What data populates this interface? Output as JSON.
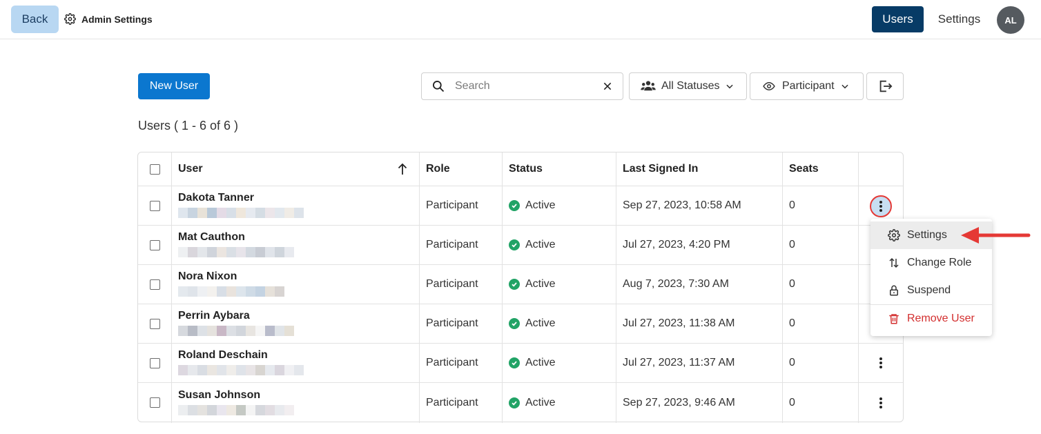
{
  "topbar": {
    "back_label": "Back",
    "breadcrumb_label": "Admin Settings",
    "nav_users": "Users",
    "nav_settings": "Settings",
    "avatar_initials": "AL"
  },
  "toolbar": {
    "new_user_label": "New User",
    "search_placeholder": "Search",
    "status_filter_label": "All Statuses",
    "role_filter_label": "Participant"
  },
  "users_title": "Users ( 1 - 6 of 6 )",
  "table": {
    "headers": {
      "user": "User",
      "role": "Role",
      "status": "Status",
      "last_signed_in": "Last Signed In",
      "seats": "Seats"
    },
    "rows": [
      {
        "name": "Dakota Tanner",
        "role": "Participant",
        "status": "Active",
        "last_signed_in": "Sep 27, 2023, 10:58 AM",
        "seats": "0"
      },
      {
        "name": "Mat Cauthon",
        "role": "Participant",
        "status": "Active",
        "last_signed_in": "Jul 27, 2023, 4:20 PM",
        "seats": "0"
      },
      {
        "name": "Nora Nixon",
        "role": "Participant",
        "status": "Active",
        "last_signed_in": "Aug 7, 2023, 7:30 AM",
        "seats": "0"
      },
      {
        "name": "Perrin Aybara",
        "role": "Participant",
        "status": "Active",
        "last_signed_in": "Jul 27, 2023, 11:38 AM",
        "seats": "0"
      },
      {
        "name": "Roland Deschain",
        "role": "Participant",
        "status": "Active",
        "last_signed_in": "Jul 27, 2023, 11:37 AM",
        "seats": "0"
      },
      {
        "name": "Susan Johnson",
        "role": "Participant",
        "status": "Active",
        "last_signed_in": "Sep 27, 2023, 9:46 AM",
        "seats": "0"
      }
    ]
  },
  "row_menu": {
    "items": [
      {
        "label": "Settings",
        "icon": "gear-icon"
      },
      {
        "label": "Change Role",
        "icon": "swap-vertical-icon"
      },
      {
        "label": "Suspend",
        "icon": "lock-icon"
      },
      {
        "label": "Remove User",
        "icon": "trash-icon"
      }
    ]
  },
  "colors": {
    "primary": "#0b77cf",
    "nav_active": "#073b66",
    "status_active": "#21a366",
    "danger": "#d32f2f",
    "annotation": "#e53935"
  }
}
